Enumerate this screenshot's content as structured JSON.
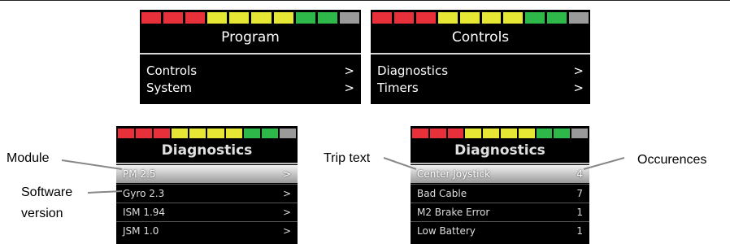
{
  "colors": {
    "red": "#e8303a",
    "yellow": "#e6e635",
    "green": "#2fb84a",
    "gray": "#9a9a9a",
    "screen": "#000000"
  },
  "status_bar": [
    "red",
    "red",
    "red",
    "yellow",
    "yellow",
    "yellow",
    "yellow",
    "green",
    "green",
    "gray"
  ],
  "panels": {
    "program": {
      "title": "Program",
      "items": [
        {
          "label": "Controls",
          "arrow": ">"
        },
        {
          "label": "System",
          "arrow": ">"
        }
      ]
    },
    "controls": {
      "title": "Controls",
      "items": [
        {
          "label": "Diagnostics",
          "arrow": ">"
        },
        {
          "label": "Timers",
          "arrow": ">"
        }
      ]
    },
    "diag_modules": {
      "title": "Diagnostics",
      "items": [
        {
          "label": "PM 2.5",
          "value": ">"
        },
        {
          "label": "Gyro 2.3",
          "value": ">"
        },
        {
          "label": "ISM 1.94",
          "value": ">"
        },
        {
          "label": "JSM 1.0",
          "value": ">"
        }
      ]
    },
    "diag_trips": {
      "title": "Diagnostics",
      "items": [
        {
          "label": "Center Joystick",
          "value": "4"
        },
        {
          "label": "Bad Cable",
          "value": "7"
        },
        {
          "label": "M2 Brake Error",
          "value": "1"
        },
        {
          "label": "Low Battery",
          "value": "1"
        }
      ]
    }
  },
  "callouts": {
    "module": "Module",
    "software_line1": "Software",
    "software_line2": "version",
    "trip_text": "Trip text",
    "occurences": "Occurences"
  }
}
